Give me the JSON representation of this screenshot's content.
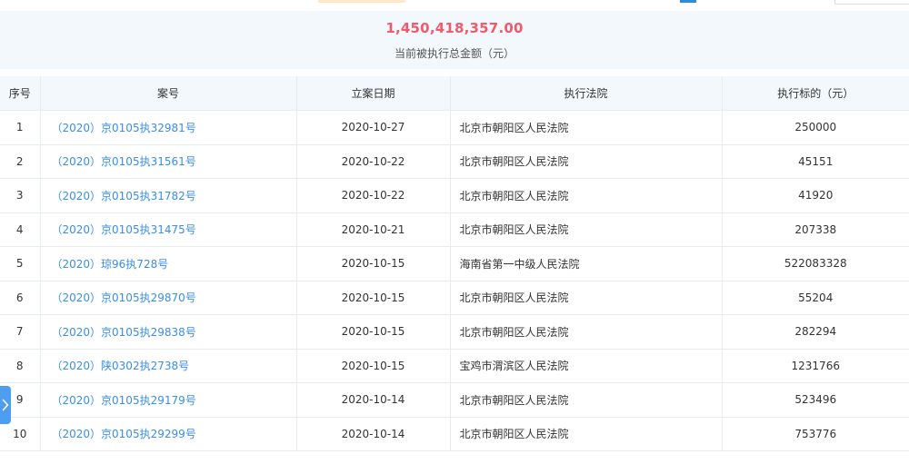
{
  "summary": {
    "total_amount": "1,450,418,357.00",
    "caption": "当前被执行总金额（元）"
  },
  "table": {
    "headers": {
      "index": "序号",
      "case_no": "案号",
      "filing_date": "立案日期",
      "court": "执行法院",
      "target": "执行标的（元）"
    },
    "rows": [
      {
        "index": "1",
        "case_no": "（2020）京0105执32981号",
        "filing_date": "2020-10-27",
        "court": "北京市朝阳区人民法院",
        "target": "250000"
      },
      {
        "index": "2",
        "case_no": "（2020）京0105执31561号",
        "filing_date": "2020-10-22",
        "court": "北京市朝阳区人民法院",
        "target": "45151"
      },
      {
        "index": "3",
        "case_no": "（2020）京0105执31782号",
        "filing_date": "2020-10-22",
        "court": "北京市朝阳区人民法院",
        "target": "41920"
      },
      {
        "index": "4",
        "case_no": "（2020）京0105执31475号",
        "filing_date": "2020-10-21",
        "court": "北京市朝阳区人民法院",
        "target": "207338"
      },
      {
        "index": "5",
        "case_no": "（2020）琼96执728号",
        "filing_date": "2020-10-15",
        "court": "海南省第一中级人民法院",
        "target": "522083328"
      },
      {
        "index": "6",
        "case_no": "（2020）京0105执29870号",
        "filing_date": "2020-10-15",
        "court": "北京市朝阳区人民法院",
        "target": "55204"
      },
      {
        "index": "7",
        "case_no": "（2020）京0105执29838号",
        "filing_date": "2020-10-15",
        "court": "北京市朝阳区人民法院",
        "target": "282294"
      },
      {
        "index": "8",
        "case_no": "（2020）陕0302执2738号",
        "filing_date": "2020-10-15",
        "court": "宝鸡市渭滨区人民法院",
        "target": "1231766"
      },
      {
        "index": "9",
        "case_no": "（2020）京0105执29179号",
        "filing_date": "2020-10-14",
        "court": "北京市朝阳区人民法院",
        "target": "523496"
      },
      {
        "index": "10",
        "case_no": "（2020）京0105执29299号",
        "filing_date": "2020-10-14",
        "court": "北京市朝阳区人民法院",
        "target": "753776"
      }
    ]
  },
  "side_handle": {
    "icon": "chevron-right-icon",
    "color": "#4d9ef0"
  },
  "colors": {
    "amount": "#ef5b6c",
    "link": "#3a8ee6",
    "header_bg": "#f2f8fb"
  }
}
